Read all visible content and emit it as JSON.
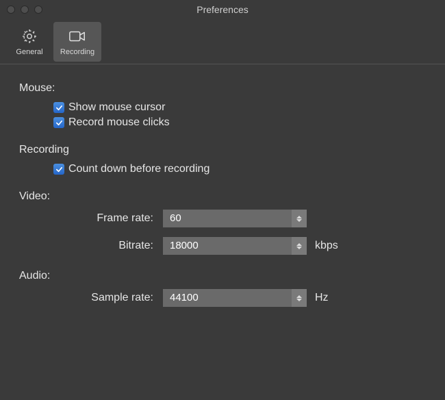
{
  "window": {
    "title": "Preferences"
  },
  "toolbar": {
    "general": {
      "label": "General"
    },
    "recording": {
      "label": "Recording"
    }
  },
  "sections": {
    "mouse": {
      "title": "Mouse:",
      "show_cursor": "Show mouse cursor",
      "record_clicks": "Record mouse clicks"
    },
    "recording": {
      "title": "Recording",
      "countdown": "Count down before recording"
    },
    "video": {
      "title": "Video:",
      "frame_rate_label": "Frame rate:",
      "frame_rate_value": "60",
      "bitrate_label": "Bitrate:",
      "bitrate_value": "18000",
      "bitrate_unit": "kbps"
    },
    "audio": {
      "title": "Audio:",
      "sample_rate_label": "Sample rate:",
      "sample_rate_value": "44100",
      "sample_rate_unit": "Hz"
    }
  }
}
